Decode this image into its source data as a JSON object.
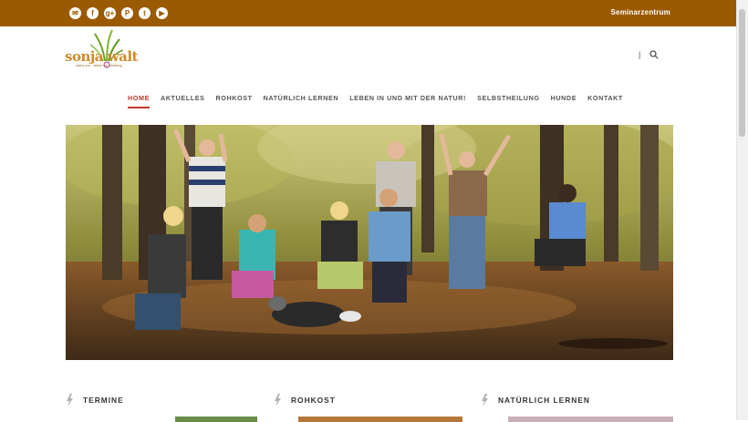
{
  "topbar": {
    "social": [
      {
        "name": "email-icon",
        "glyph": "✉"
      },
      {
        "name": "facebook-icon",
        "glyph": "f"
      },
      {
        "name": "google-plus-icon",
        "glyph": "g+"
      },
      {
        "name": "pinterest-icon",
        "glyph": "P"
      },
      {
        "name": "twitter-icon",
        "glyph": "t"
      },
      {
        "name": "youtube-icon",
        "glyph": "▶"
      }
    ],
    "seminar_link": "Seminarzentrum"
  },
  "logo": {
    "wordmark": "sonja walt",
    "tagline": "natur pur · leben im einklang"
  },
  "nav": {
    "items": [
      {
        "label": "HOME"
      },
      {
        "label": "AKTUELLES"
      },
      {
        "label": "ROHKOST"
      },
      {
        "label": "NATÜRLICH LERNEN"
      },
      {
        "label": "LEBEN IN UND MIT DER NATUR!"
      },
      {
        "label": "SELBSTHEILUNG"
      },
      {
        "label": "HUNDE"
      },
      {
        "label": "KONTAKT"
      }
    ]
  },
  "tools": {
    "separator": "|"
  },
  "sections": [
    {
      "title": "TERMINE"
    },
    {
      "title": "ROHKOST"
    },
    {
      "title": "NATÜRLICH LERNEN"
    }
  ],
  "colors": {
    "brand": "#9a5a00",
    "accent": "#c0392b"
  }
}
